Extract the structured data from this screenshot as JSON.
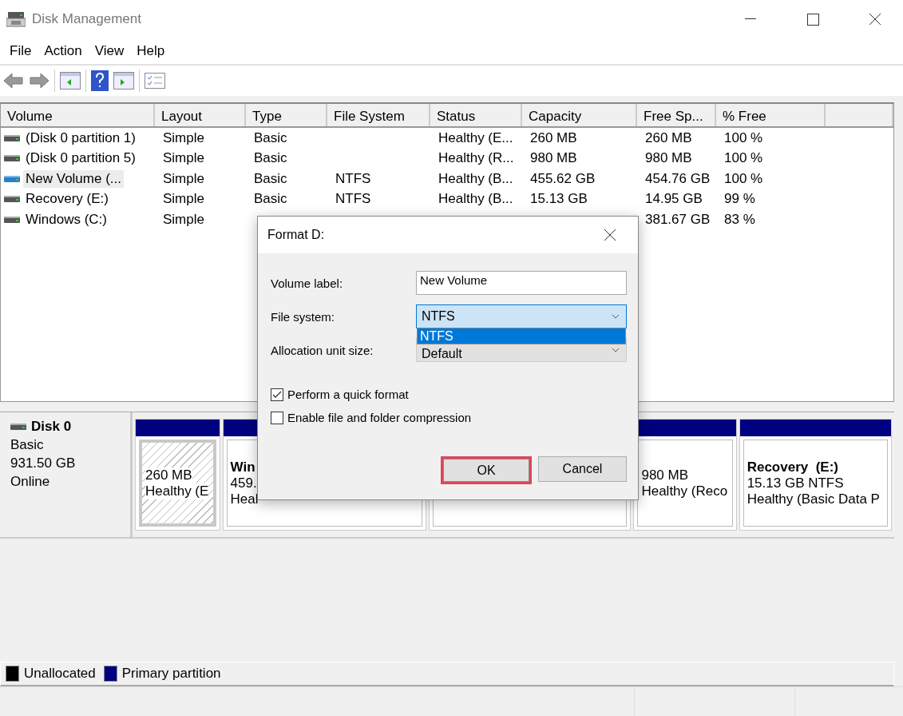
{
  "window": {
    "title": "Disk Management"
  },
  "menu": [
    "File",
    "Action",
    "View",
    "Help"
  ],
  "volume_table": {
    "columns": [
      "Volume",
      "Layout",
      "Type",
      "File System",
      "Status",
      "Capacity",
      "Free Sp...",
      "% Free"
    ],
    "rows": [
      {
        "cells": [
          "(Disk 0 partition 1)",
          "Simple",
          "Basic",
          null,
          "Healthy (E...",
          "260 MB",
          "260 MB",
          "100 %"
        ],
        "selected": false
      },
      {
        "cells": [
          "(Disk 0 partition 5)",
          "Simple",
          "Basic",
          null,
          "Healthy (R...",
          "980 MB",
          "980 MB",
          "100 %"
        ],
        "selected": false
      },
      {
        "cells": [
          "New Volume (...",
          "Simple",
          "Basic",
          "NTFS",
          "Healthy (B...",
          "455.62 GB",
          "454.76 GB",
          "100 %"
        ],
        "selected": true
      },
      {
        "cells": [
          "Recovery (E:)",
          "Simple",
          "Basic",
          "NTFS",
          "Healthy (B...",
          "15.13 GB",
          "14.95 GB",
          "99 %"
        ],
        "selected": false
      },
      {
        "cells": [
          "Windows (C:)",
          "Simple",
          null,
          null,
          null,
          null,
          "381.67 GB",
          "83 %"
        ],
        "selected": false
      }
    ]
  },
  "disk_map": {
    "disk": {
      "name": "Disk 0",
      "type": "Basic",
      "size": "931.50 GB",
      "status": "Online"
    },
    "partitions": [
      {
        "lines": [
          "260 MB",
          "Healthy (E"
        ],
        "selected": true
      },
      {
        "title": "Win",
        "lines": [
          "459.",
          "Heal"
        ],
        "selected": false
      },
      {
        "selected": false
      },
      {
        "lines": [
          "980 MB",
          "Healthy (Reco"
        ],
        "selected": false
      },
      {
        "title": "Recovery  (E:)",
        "lines": [
          "15.13 GB NTFS",
          "Healthy (Basic Data P"
        ],
        "selected": false
      }
    ]
  },
  "legend": [
    {
      "label": "Unallocated",
      "color": "#000000"
    },
    {
      "label": "Primary partition",
      "color": "#000080"
    }
  ],
  "dialog": {
    "title": "Format D:",
    "fields": [
      {
        "kind": "text",
        "label": "Volume label:",
        "value": "New Volume"
      },
      {
        "kind": "dropdown",
        "label": "File system:",
        "value": "NTFS",
        "expanded": true,
        "options": [
          {
            "label": "NTFS",
            "selected": true
          }
        ]
      },
      {
        "kind": "dropdown",
        "label": "Allocation unit size:",
        "value": "Default",
        "expanded": false
      }
    ],
    "checkboxes": [
      {
        "label": "Perform a quick format",
        "checked": true
      },
      {
        "label": "Enable file and folder compression",
        "checked": false
      }
    ],
    "buttons": [
      {
        "label": "OK",
        "focused": true
      },
      {
        "label": "Cancel",
        "focused": false
      }
    ]
  }
}
